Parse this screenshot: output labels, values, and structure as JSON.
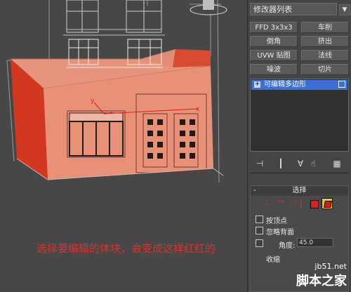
{
  "viewport": {
    "annotation": "选择要编辑的体块，会变成这样红红的"
  },
  "panel": {
    "modifier_list": "修改器列表",
    "buttons": [
      {
        "label": "FFD 3x3x3"
      },
      {
        "label": "车削"
      },
      {
        "label": "倒角"
      },
      {
        "label": "挤出"
      },
      {
        "label": "UVW 贴图"
      },
      {
        "label": "法线"
      },
      {
        "label": "噪波"
      },
      {
        "label": "切片"
      }
    ],
    "stack": {
      "item": "可编辑多边形"
    },
    "rollout": {
      "title": "选择",
      "options": {
        "by_vertex": "按顶点",
        "ignore_backfacing": "忽略背面",
        "angle_label": "角度:",
        "angle_value": "45.0",
        "shrink": "收缩"
      }
    }
  },
  "watermark": {
    "site": "jb51.net",
    "name": "脚本之家"
  },
  "colors": {
    "selected_face": "#e99177",
    "selected_face_dark": "#d2371f",
    "selection_active": "#f0d000",
    "stack_highlight": "#3b6fd8"
  }
}
